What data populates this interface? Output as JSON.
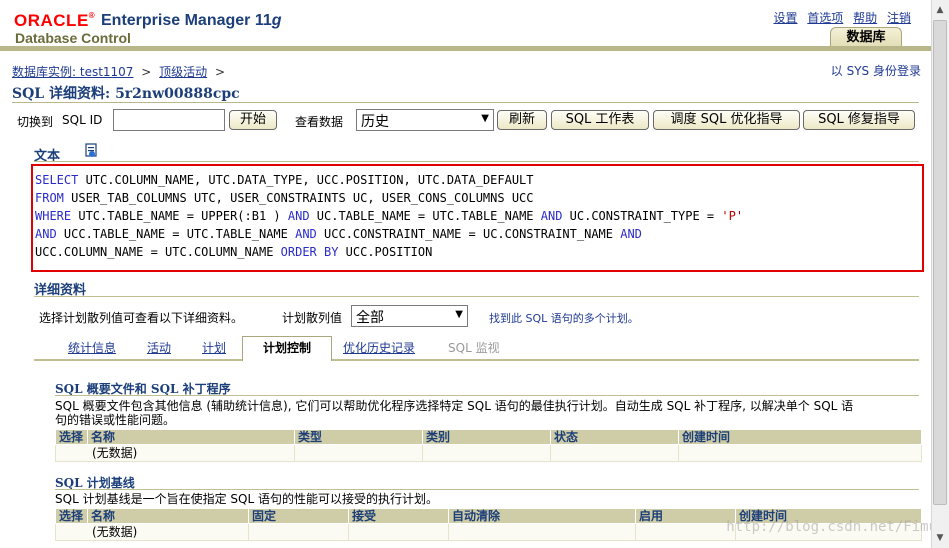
{
  "header": {
    "logo": "ORACLE",
    "product": "Enterprise Manager 11",
    "product_version": "g",
    "subtitle": "Database Control",
    "links": [
      "设置",
      "首选项",
      "帮助",
      "注销"
    ],
    "db_tab": "数据库"
  },
  "breadcrumb": {
    "items": [
      "数据库实例: test1107",
      "顶级活动"
    ],
    "separator": ">",
    "login": "以 SYS 身份登录"
  },
  "page_title": "SQL 详细资料: 5r2nw00888cpc",
  "toolbar": {
    "switch_label": "切换到",
    "sqlid_label": "SQL ID",
    "sqlid_value": "",
    "start_button": "开始",
    "view_label": "查看数据",
    "view_value": "历史",
    "refresh_button": "刷新",
    "worksheet_button": "SQL 工作表",
    "tune_button": "调度 SQL 优化指导",
    "repair_button": "SQL 修复指导"
  },
  "text_section": {
    "title": "文本",
    "sql_lines": [
      [
        {
          "t": "SELECT",
          "k": 1
        },
        {
          "t": " UTC.COLUMN_NAME, UTC.DATA_TYPE, UCC.POSITION, UTC.DATA_DEFAULT"
        }
      ],
      [
        {
          "t": "FROM",
          "k": 1
        },
        {
          "t": " USER_TAB_COLUMNS UTC, USER_CONSTRAINTS UC, USER_CONS_COLUMNS UCC"
        }
      ],
      [
        {
          "t": "WHERE",
          "k": 1
        },
        {
          "t": " UTC.TABLE_NAME = UPPER(:B1 ) "
        },
        {
          "t": "AND",
          "k": 1
        },
        {
          "t": " UC.TABLE_NAME = UTC.TABLE_NAME "
        },
        {
          "t": "AND",
          "k": 1
        },
        {
          "t": " UC.CONSTRAINT_TYPE = "
        },
        {
          "t": "'P'",
          "s": 1
        }
      ],
      [
        {
          "t": "AND",
          "k": 1
        },
        {
          "t": " UCC.TABLE_NAME = UTC.TABLE_NAME "
        },
        {
          "t": "AND",
          "k": 1
        },
        {
          "t": " UCC.CONSTRAINT_NAME = UC.CONSTRAINT_NAME "
        },
        {
          "t": "AND",
          "k": 1
        }
      ],
      [
        {
          "t": "UCC.COLUMN_NAME = UTC.COLUMN_NAME "
        },
        {
          "t": "ORDER BY",
          "k": 1
        },
        {
          "t": " UCC.POSITION"
        }
      ]
    ]
  },
  "details": {
    "title": "详细资料",
    "hint": "选择计划散列值可查看以下详细资料。",
    "hash_label": "计划散列值",
    "hash_value": "全部",
    "multi_plan_link": "找到此 SQL 语句的多个计划。",
    "tabs": [
      "统计信息",
      "活动",
      "计划",
      "计划控制",
      "优化历史记录",
      "SQL 监视"
    ],
    "active_tab": "计划控制"
  },
  "profiles": {
    "title": "SQL 概要文件和 SQL 补丁程序",
    "desc_line1": "SQL 概要文件包含其他信息 (辅助统计信息), 它们可以帮助优化程序选择特定 SQL 语句的最佳执行计划。自动生成 SQL 补丁程序, 以解决单个 SQL 语",
    "desc_line2": "句的错误或性能问题。",
    "columns": [
      "选择",
      "名称",
      "类型",
      "类别",
      "状态",
      "创建时间"
    ],
    "empty": "(无数据)"
  },
  "baselines": {
    "title": "SQL 计划基线",
    "desc": "SQL 计划基线是一个旨在使指定 SQL 语句的性能可以接受的执行计划。",
    "columns": [
      "选择",
      "名称",
      "固定",
      "接受",
      "自动清除",
      "启用",
      "创建时间"
    ],
    "empty": "(无数据)"
  },
  "watermark": "http://blog.csdn.net/Fimu"
}
